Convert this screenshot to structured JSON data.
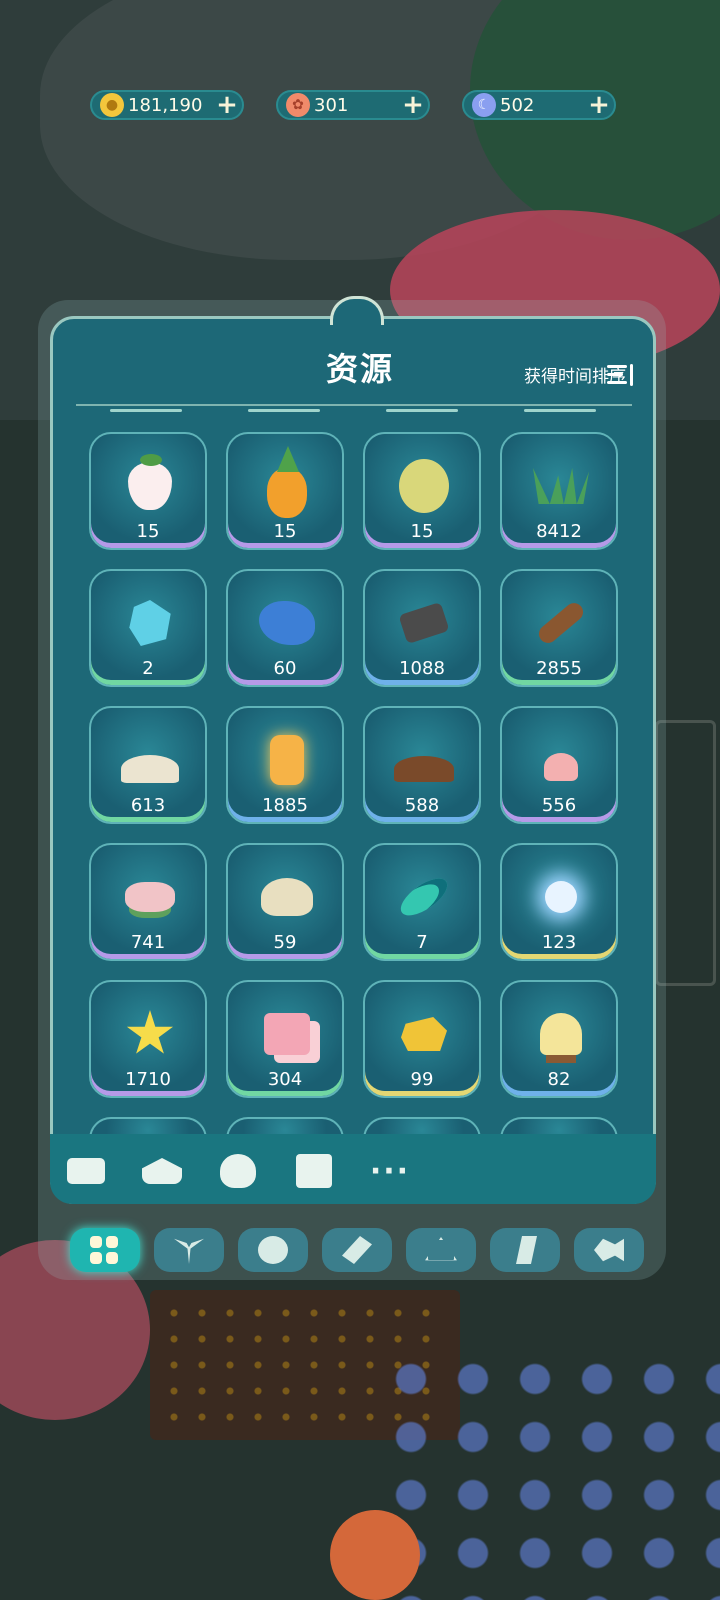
{
  "currencies": [
    {
      "name": "coins",
      "value": "181,190",
      "icon": "coin-icon",
      "color": "#f3c63c"
    },
    {
      "name": "flower-tokens",
      "value": "301",
      "icon": "flower-coin-icon",
      "color": "#f08a6a"
    },
    {
      "name": "moon-tokens",
      "value": "502",
      "icon": "moon-coin-icon",
      "color": "#8a9ff0"
    }
  ],
  "panel": {
    "title": "资源",
    "sort_label": "获得时间排序",
    "sort_icon": "sort-icon"
  },
  "items": [
    {
      "name": "strawberry",
      "count": "15",
      "art": "straw",
      "border": "purple"
    },
    {
      "name": "pineapple",
      "count": "15",
      "art": "pine",
      "border": "purple"
    },
    {
      "name": "melon",
      "count": "15",
      "art": "melon",
      "border": "purple"
    },
    {
      "name": "grass-bundle",
      "count": "8412",
      "art": "grass",
      "border": "purple"
    },
    {
      "name": "crystal",
      "count": "2",
      "art": "crystal",
      "border": "green"
    },
    {
      "name": "fishing-net",
      "count": "60",
      "art": "net",
      "border": "purple"
    },
    {
      "name": "iron-pipe",
      "count": "1088",
      "art": "pipe",
      "border": "blue"
    },
    {
      "name": "wood-log",
      "count": "2855",
      "art": "log",
      "border": "green"
    },
    {
      "name": "flour",
      "count": "613",
      "art": "flour",
      "border": "green"
    },
    {
      "name": "honey-jar",
      "count": "1885",
      "art": "jar",
      "border": "blue"
    },
    {
      "name": "soil",
      "count": "588",
      "art": "soilp",
      "border": "blue"
    },
    {
      "name": "cream",
      "count": "556",
      "art": "cream",
      "border": "purple"
    },
    {
      "name": "rice-cake",
      "count": "741",
      "art": "rice",
      "border": "purple"
    },
    {
      "name": "pearl-shell",
      "count": "59",
      "art": "shell",
      "border": "purple"
    },
    {
      "name": "feather",
      "count": "7",
      "art": "feather",
      "border": "green"
    },
    {
      "name": "spirit-wisp",
      "count": "123",
      "art": "wisp",
      "border": "yellow"
    },
    {
      "name": "star",
      "count": "1710",
      "art": "star",
      "border": "purple"
    },
    {
      "name": "candy-cubes",
      "count": "304",
      "art": "cubes",
      "border": "green"
    },
    {
      "name": "gold-nugget",
      "count": "99",
      "art": "gold",
      "border": "yellow"
    },
    {
      "name": "cupcake",
      "count": "82",
      "art": "cupcake",
      "border": "blue"
    }
  ],
  "toolbar": [
    "briefcase-icon",
    "hanger-icon",
    "rice-bowl-icon",
    "book-icon",
    "more-icon"
  ],
  "categories": [
    "all-grid-icon",
    "sprout-icon",
    "flower-icon",
    "tools-icon",
    "hanger-icon",
    "music-icon",
    "fish-icon"
  ],
  "active_category": "all-grid-icon"
}
